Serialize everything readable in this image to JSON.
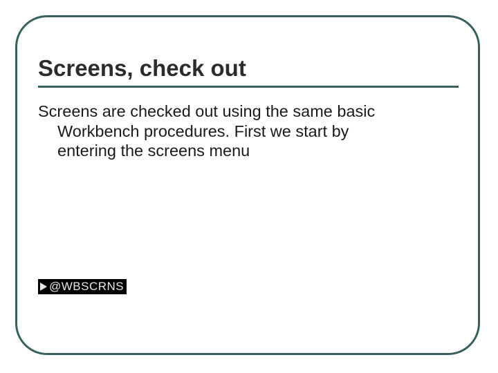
{
  "slide": {
    "title": "Screens, check out",
    "body_line1": "Screens are checked out using the same basic",
    "body_line2": "Workbench procedures.   First we start by",
    "body_line3": "entering the screens menu"
  },
  "menu": {
    "label": "@WBSCRNS"
  },
  "colors": {
    "frame": "#35605e",
    "menu_bg": "#000000",
    "menu_fg": "#e6e6e6"
  }
}
